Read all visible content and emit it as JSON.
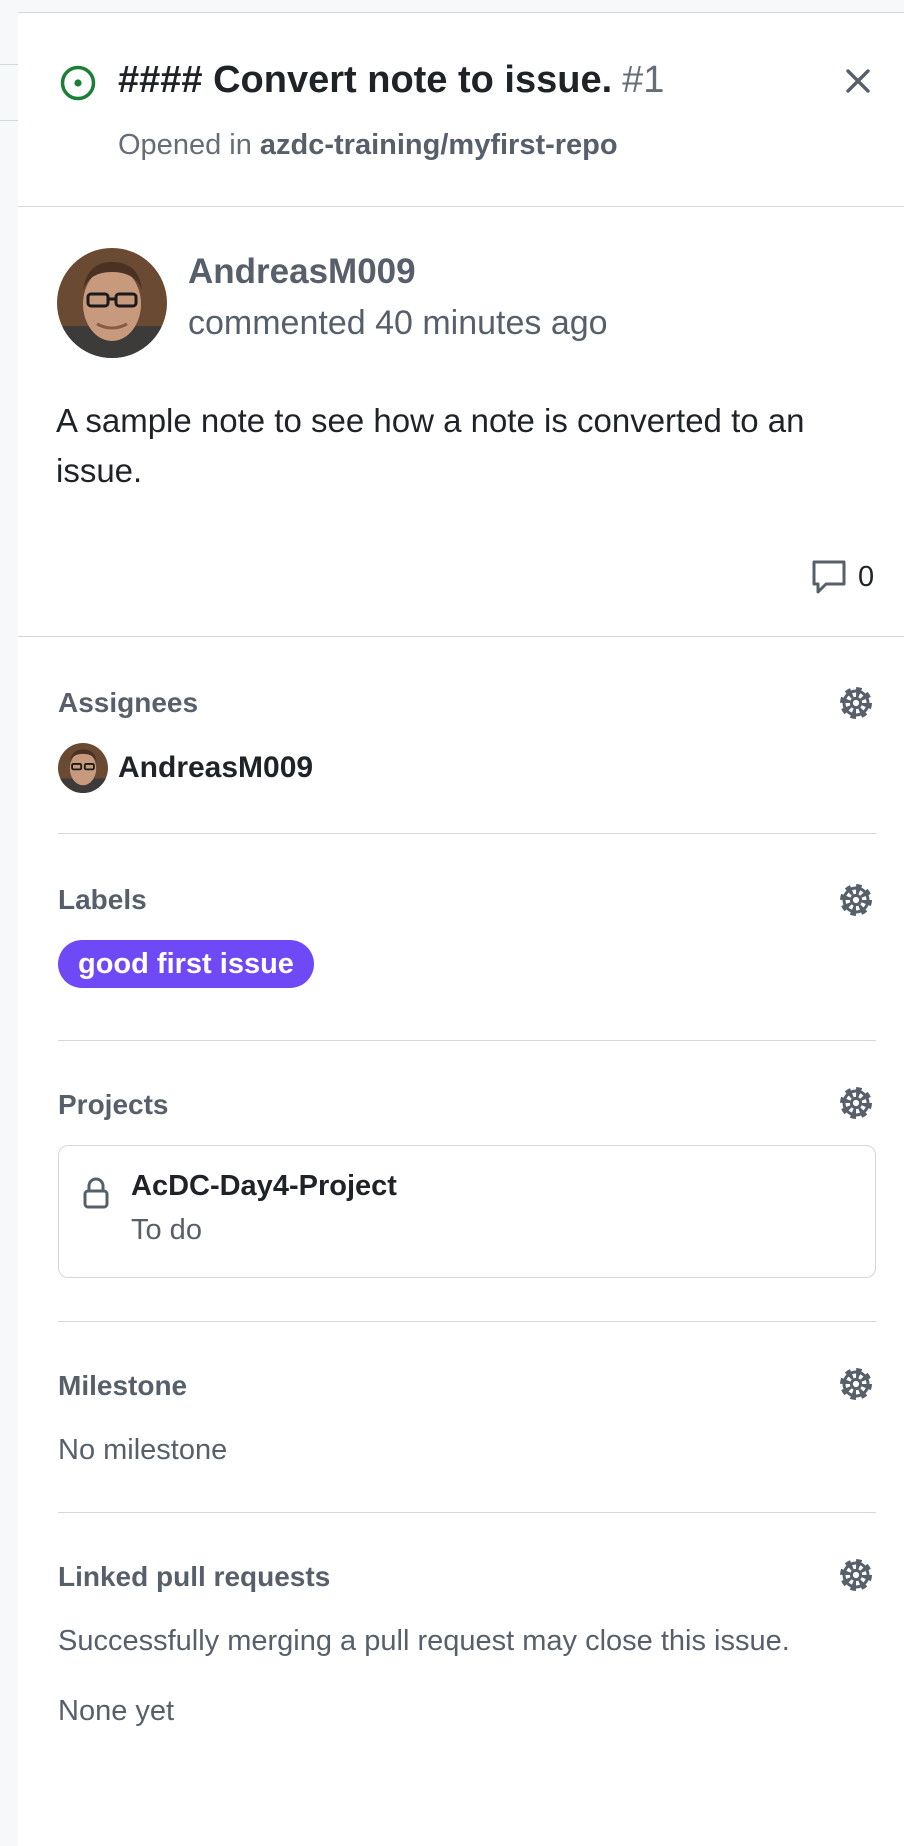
{
  "issue": {
    "title": "#### Convert note to issue.",
    "number": "#1",
    "opened_prefix": "Opened in",
    "repo": "azdc-training/myfirst-repo",
    "state_color": "#1a7f37"
  },
  "comment": {
    "author": "AndreasM009",
    "meta": "commented 40 minutes ago",
    "body": "A sample note to see how a note is converted to an issue.",
    "comment_count": "0"
  },
  "sidebar": {
    "assignees": {
      "title": "Assignees",
      "users": [
        "AndreasM009"
      ]
    },
    "labels": {
      "title": "Labels",
      "items": [
        {
          "name": "good first issue",
          "color": "#6e49f5"
        }
      ]
    },
    "projects": {
      "title": "Projects",
      "items": [
        {
          "name": "AcDC-Day4-Project",
          "status": "To do"
        }
      ]
    },
    "milestone": {
      "title": "Milestone",
      "value": "No milestone"
    },
    "linked_prs": {
      "title": "Linked pull requests",
      "description": "Successfully merging a pull request may close this issue.",
      "value": "None yet"
    }
  },
  "icons": [
    "issue-opened-icon",
    "close-icon",
    "comment-icon",
    "gear-icon",
    "lock-icon"
  ]
}
